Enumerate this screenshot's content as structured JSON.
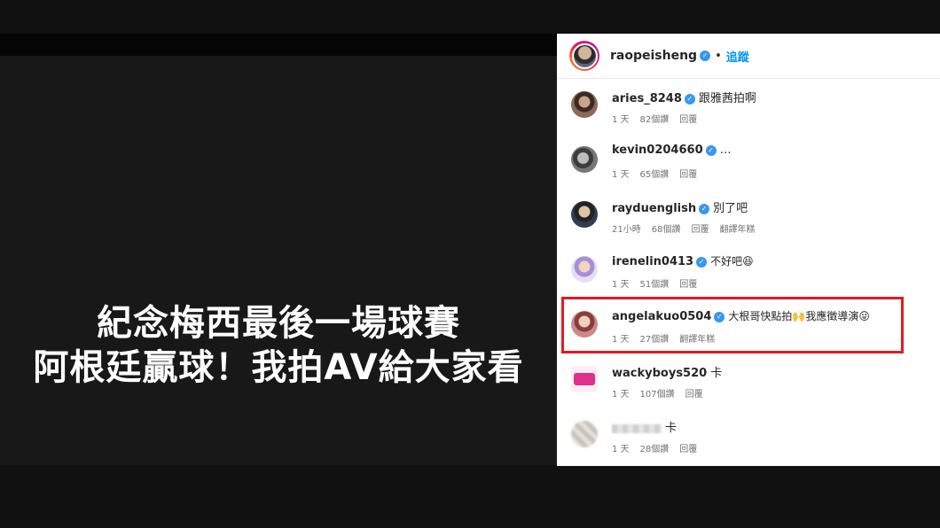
{
  "headline": {
    "line1": "紀念梅西最後一場球賽",
    "line2": "阿根廷贏球！我拍AV給大家看"
  },
  "post": {
    "username": "raopeisheng",
    "separator": "•",
    "follow_label": "追蹤"
  },
  "comments": [
    {
      "user": "aries_8248",
      "text": "跟雅茜拍啊",
      "time": "1 天",
      "likes": "82個讚",
      "reply": "回覆",
      "translate": ""
    },
    {
      "user": "kevin0204660",
      "text": "…",
      "time": "1 天",
      "likes": "65個讚",
      "reply": "回覆",
      "translate": ""
    },
    {
      "user": "rayduenglish",
      "text": "別了吧",
      "time": "21小時",
      "likes": "68個讚",
      "reply": "回覆",
      "translate": "翻譯年糕"
    },
    {
      "user": "irenelin0413",
      "text": "不好吧😆",
      "time": "1 天",
      "likes": "51個讚",
      "reply": "回覆",
      "translate": ""
    },
    {
      "user": "angelakuo0504",
      "text": "大根哥快點拍🙌我應徵導演😜",
      "time": "1 天",
      "likes": "27個讚",
      "reply": "",
      "translate": "翻譯年糕"
    },
    {
      "user": "wackyboys520",
      "text": "卡",
      "time": "1 天",
      "likes": "107個讚",
      "reply": "回覆",
      "translate": ""
    },
    {
      "user": "",
      "text": "卡",
      "time": "1 天",
      "likes": "28個讚",
      "reply": "回覆",
      "translate": ""
    }
  ],
  "colors": {
    "highlight": "#e11b22",
    "verified": "#3897f0",
    "follow": "#0095f6"
  }
}
